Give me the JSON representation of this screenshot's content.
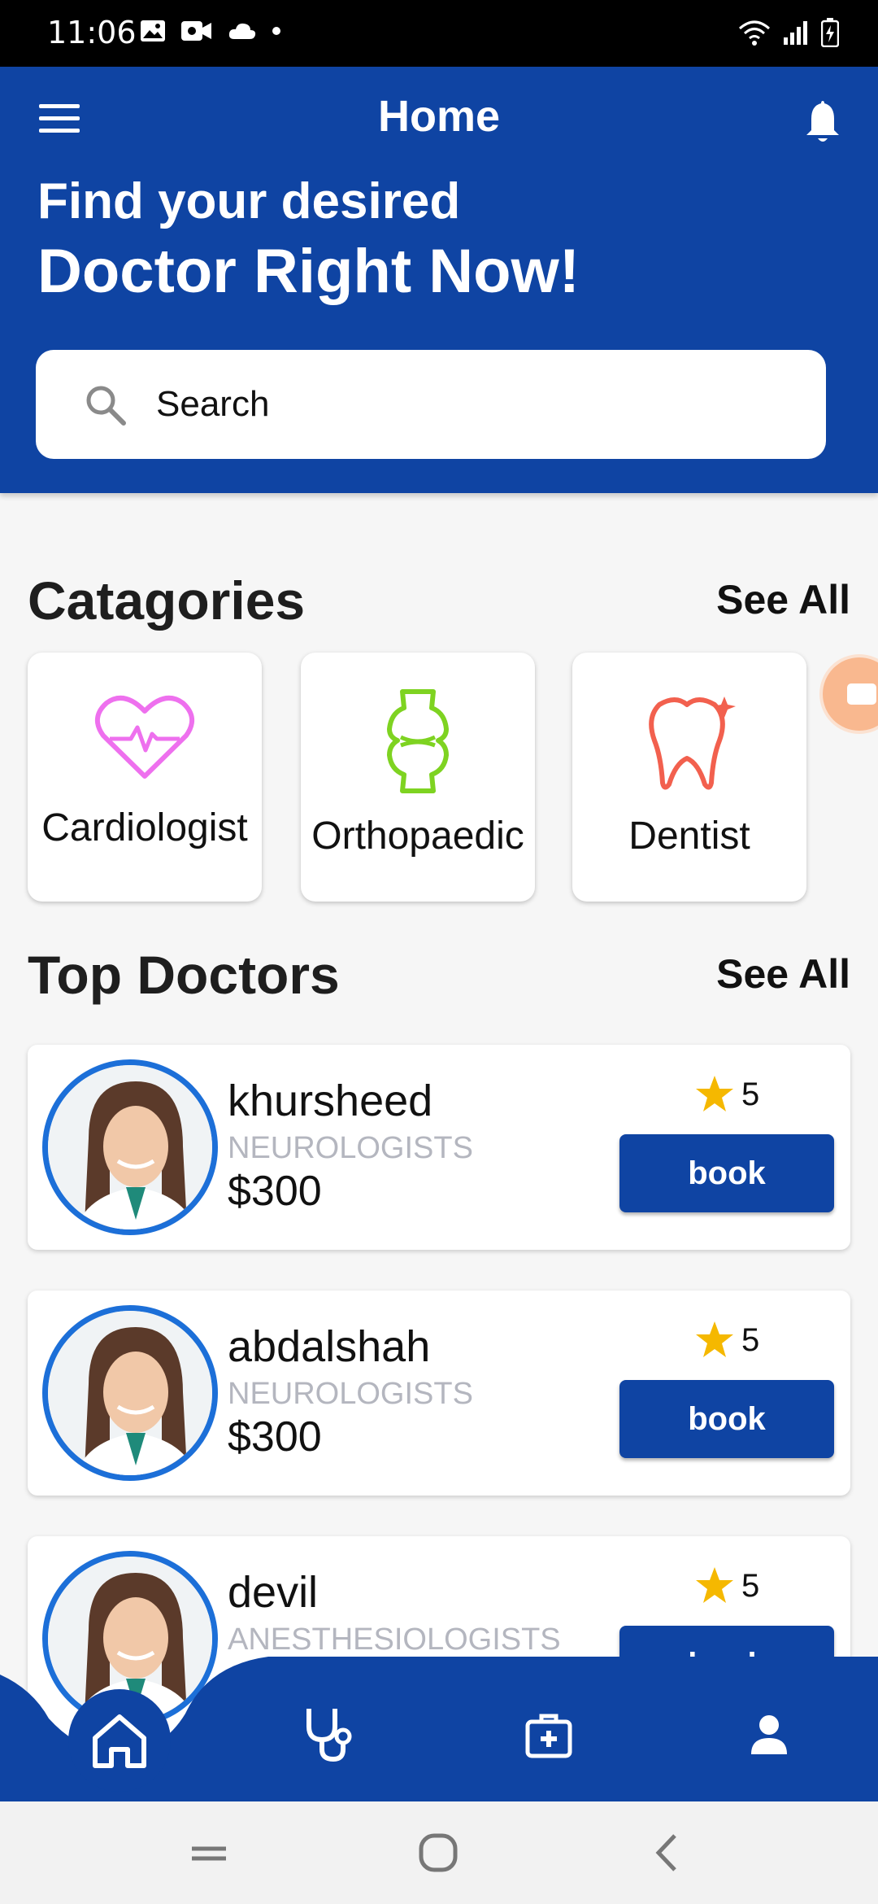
{
  "status_bar": {
    "time": "11:06"
  },
  "header": {
    "title": "Home",
    "headline_line1": "Find your desired",
    "headline_line2": "Doctor Right Now!"
  },
  "search": {
    "placeholder": "Search"
  },
  "categories": {
    "title": "Catagories",
    "see_all": "See All",
    "items": [
      {
        "label": "Cardiologist",
        "icon": "heart-pulse-icon",
        "color": "#ee70ee"
      },
      {
        "label": "Orthopaedic",
        "icon": "bone-joint-icon",
        "color": "#7ed321"
      },
      {
        "label": "Dentist",
        "icon": "tooth-icon",
        "color": "#f2604e"
      }
    ]
  },
  "top_doctors": {
    "title": "Top Doctors",
    "see_all": "See All",
    "items": [
      {
        "name": "khursheed",
        "specialty": "NEUROLOGISTS",
        "price": "$300",
        "rating": "5",
        "action": "book"
      },
      {
        "name": "abdalshah",
        "specialty": "NEUROLOGISTS",
        "price": "$300",
        "rating": "5",
        "action": "book"
      },
      {
        "name": "devil",
        "specialty": "ANESTHESIOLOGISTS",
        "price": "",
        "rating": "5",
        "action": "book"
      }
    ]
  },
  "bottom_nav": {
    "items": [
      "home-icon",
      "stethoscope-icon",
      "first-aid-kit-icon",
      "profile-icon"
    ]
  },
  "colors": {
    "primary": "#0f44a3",
    "avatar_ring": "#1c6fd8",
    "star": "#f5b800",
    "muted_text": "#b4b6bf"
  }
}
